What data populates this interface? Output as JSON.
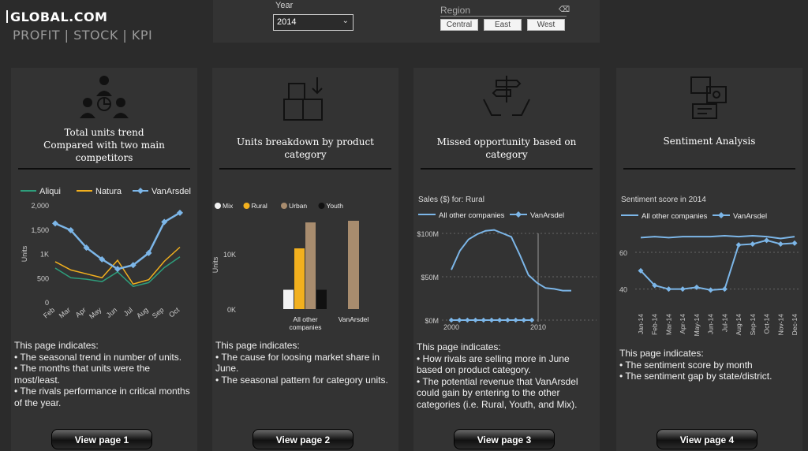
{
  "brand": {
    "name": "GLOBAL.COM",
    "subtitle": "PROFIT | STOCK | KPI"
  },
  "filters": {
    "year_label": "Year",
    "year_value": "2014",
    "region_label": "Region",
    "regions": [
      "Central",
      "East",
      "West"
    ]
  },
  "cards": [
    {
      "title_line1": "Total units trend",
      "title_line2": "Compared with two main competitors",
      "desc": [
        "This page indicates:",
        "• The seasonal trend in number of units.",
        "• The months that units were the most/least.",
        "•  The rivals performance in critical months of the year."
      ],
      "button": "View page 1"
    },
    {
      "title_line1": "Units breakdown by product category",
      "desc": [
        "This page indicates:",
        "• The cause for loosing market share in June.",
        "• The seasonal pattern for category units."
      ],
      "button": "View page 2"
    },
    {
      "title_line1": "Missed opportunity based on category",
      "desc": [
        "This page indicates:",
        "• How rivals are selling more in June based on product category.",
        "• The potential revenue that VanArsdel could gain by entering to the other categories (i.e. Rural, Youth, and Mix)."
      ],
      "button": "View page 3"
    },
    {
      "title_line1": "Sentiment Analysis",
      "desc": [
        "This page indicates:",
        "• The sentiment score by month",
        "• The sentiment gap by state/district."
      ],
      "button": "View page 4"
    }
  ],
  "chart_data": [
    {
      "type": "line",
      "title": "",
      "ylabel": "Units",
      "categories": [
        "Feb",
        "Mar",
        "Apr",
        "May",
        "Jun",
        "Jul",
        "Aug",
        "Sep",
        "Oct"
      ],
      "yticks": [
        "0",
        "500",
        "1K",
        "1,500",
        "2,000"
      ],
      "ylim": [
        0,
        2000
      ],
      "series": [
        {
          "name": "Aliqui",
          "color": "#2e9e7c",
          "values": [
            700,
            500,
            470,
            420,
            620,
            320,
            400,
            710,
            930
          ]
        },
        {
          "name": "Natura",
          "color": "#f2b01e",
          "values": [
            830,
            660,
            580,
            500,
            860,
            370,
            460,
            840,
            1130
          ]
        },
        {
          "name": "VanArsdel",
          "color": "#7cb6e8",
          "values": [
            1620,
            1480,
            1120,
            880,
            680,
            760,
            1010,
            1650,
            1840
          ]
        }
      ]
    },
    {
      "type": "bar",
      "ylabel": "Units",
      "yticks": [
        "0K",
        "10K"
      ],
      "categories": [
        "All other companies",
        "VanArsdel"
      ],
      "series": [
        {
          "name": "Mix",
          "color": "#f2f2f2",
          "values": [
            3500,
            0
          ]
        },
        {
          "name": "Rural",
          "color": "#f2b01e",
          "values": [
            11000,
            0
          ]
        },
        {
          "name": "Urban",
          "color": "#a88c6e",
          "values": [
            15700,
            16000
          ]
        },
        {
          "name": "Youth",
          "color": "#111111",
          "values": [
            3500,
            0
          ]
        }
      ]
    },
    {
      "type": "line",
      "title": "Sales ($) for: Rural",
      "x": [
        "2000",
        "2010"
      ],
      "yticks": [
        "$0M",
        "$50M",
        "$100M"
      ],
      "ylim": [
        0,
        100
      ],
      "series": [
        {
          "name": "All other companies",
          "color": "#7cb6e8",
          "values": [
            58,
            80,
            93,
            99,
            103,
            104,
            100,
            96,
            75,
            52,
            43,
            37,
            36,
            34,
            34
          ]
        },
        {
          "name": "VanArsdel",
          "color": "#7cb6e8",
          "values": [
            0,
            0,
            0,
            0,
            0,
            0,
            0,
            0,
            0,
            0,
            0
          ]
        }
      ]
    },
    {
      "type": "line",
      "title": "Sentiment score in 2014",
      "categories": [
        "Jan-14",
        "Feb-14",
        "Mar-14",
        "Apr-14",
        "May-14",
        "Jun-14",
        "Jul-14",
        "Aug-14",
        "Sep-14",
        "Oct-14",
        "Nov-14",
        "Dec-14"
      ],
      "yticks": [
        "40",
        "60"
      ],
      "ylim": [
        30,
        75
      ],
      "series": [
        {
          "name": "All other companies",
          "color": "#7cb6e8",
          "values": [
            68,
            68.5,
            68,
            68.5,
            68.5,
            68.5,
            69,
            68.5,
            69,
            68.5,
            67.5,
            68.5
          ]
        },
        {
          "name": "VanArsdel",
          "color": "#7cb6e8",
          "values": [
            50,
            42,
            40,
            40,
            41,
            39.5,
            40,
            64,
            64.5,
            66.5,
            64.5,
            65
          ]
        }
      ]
    }
  ]
}
